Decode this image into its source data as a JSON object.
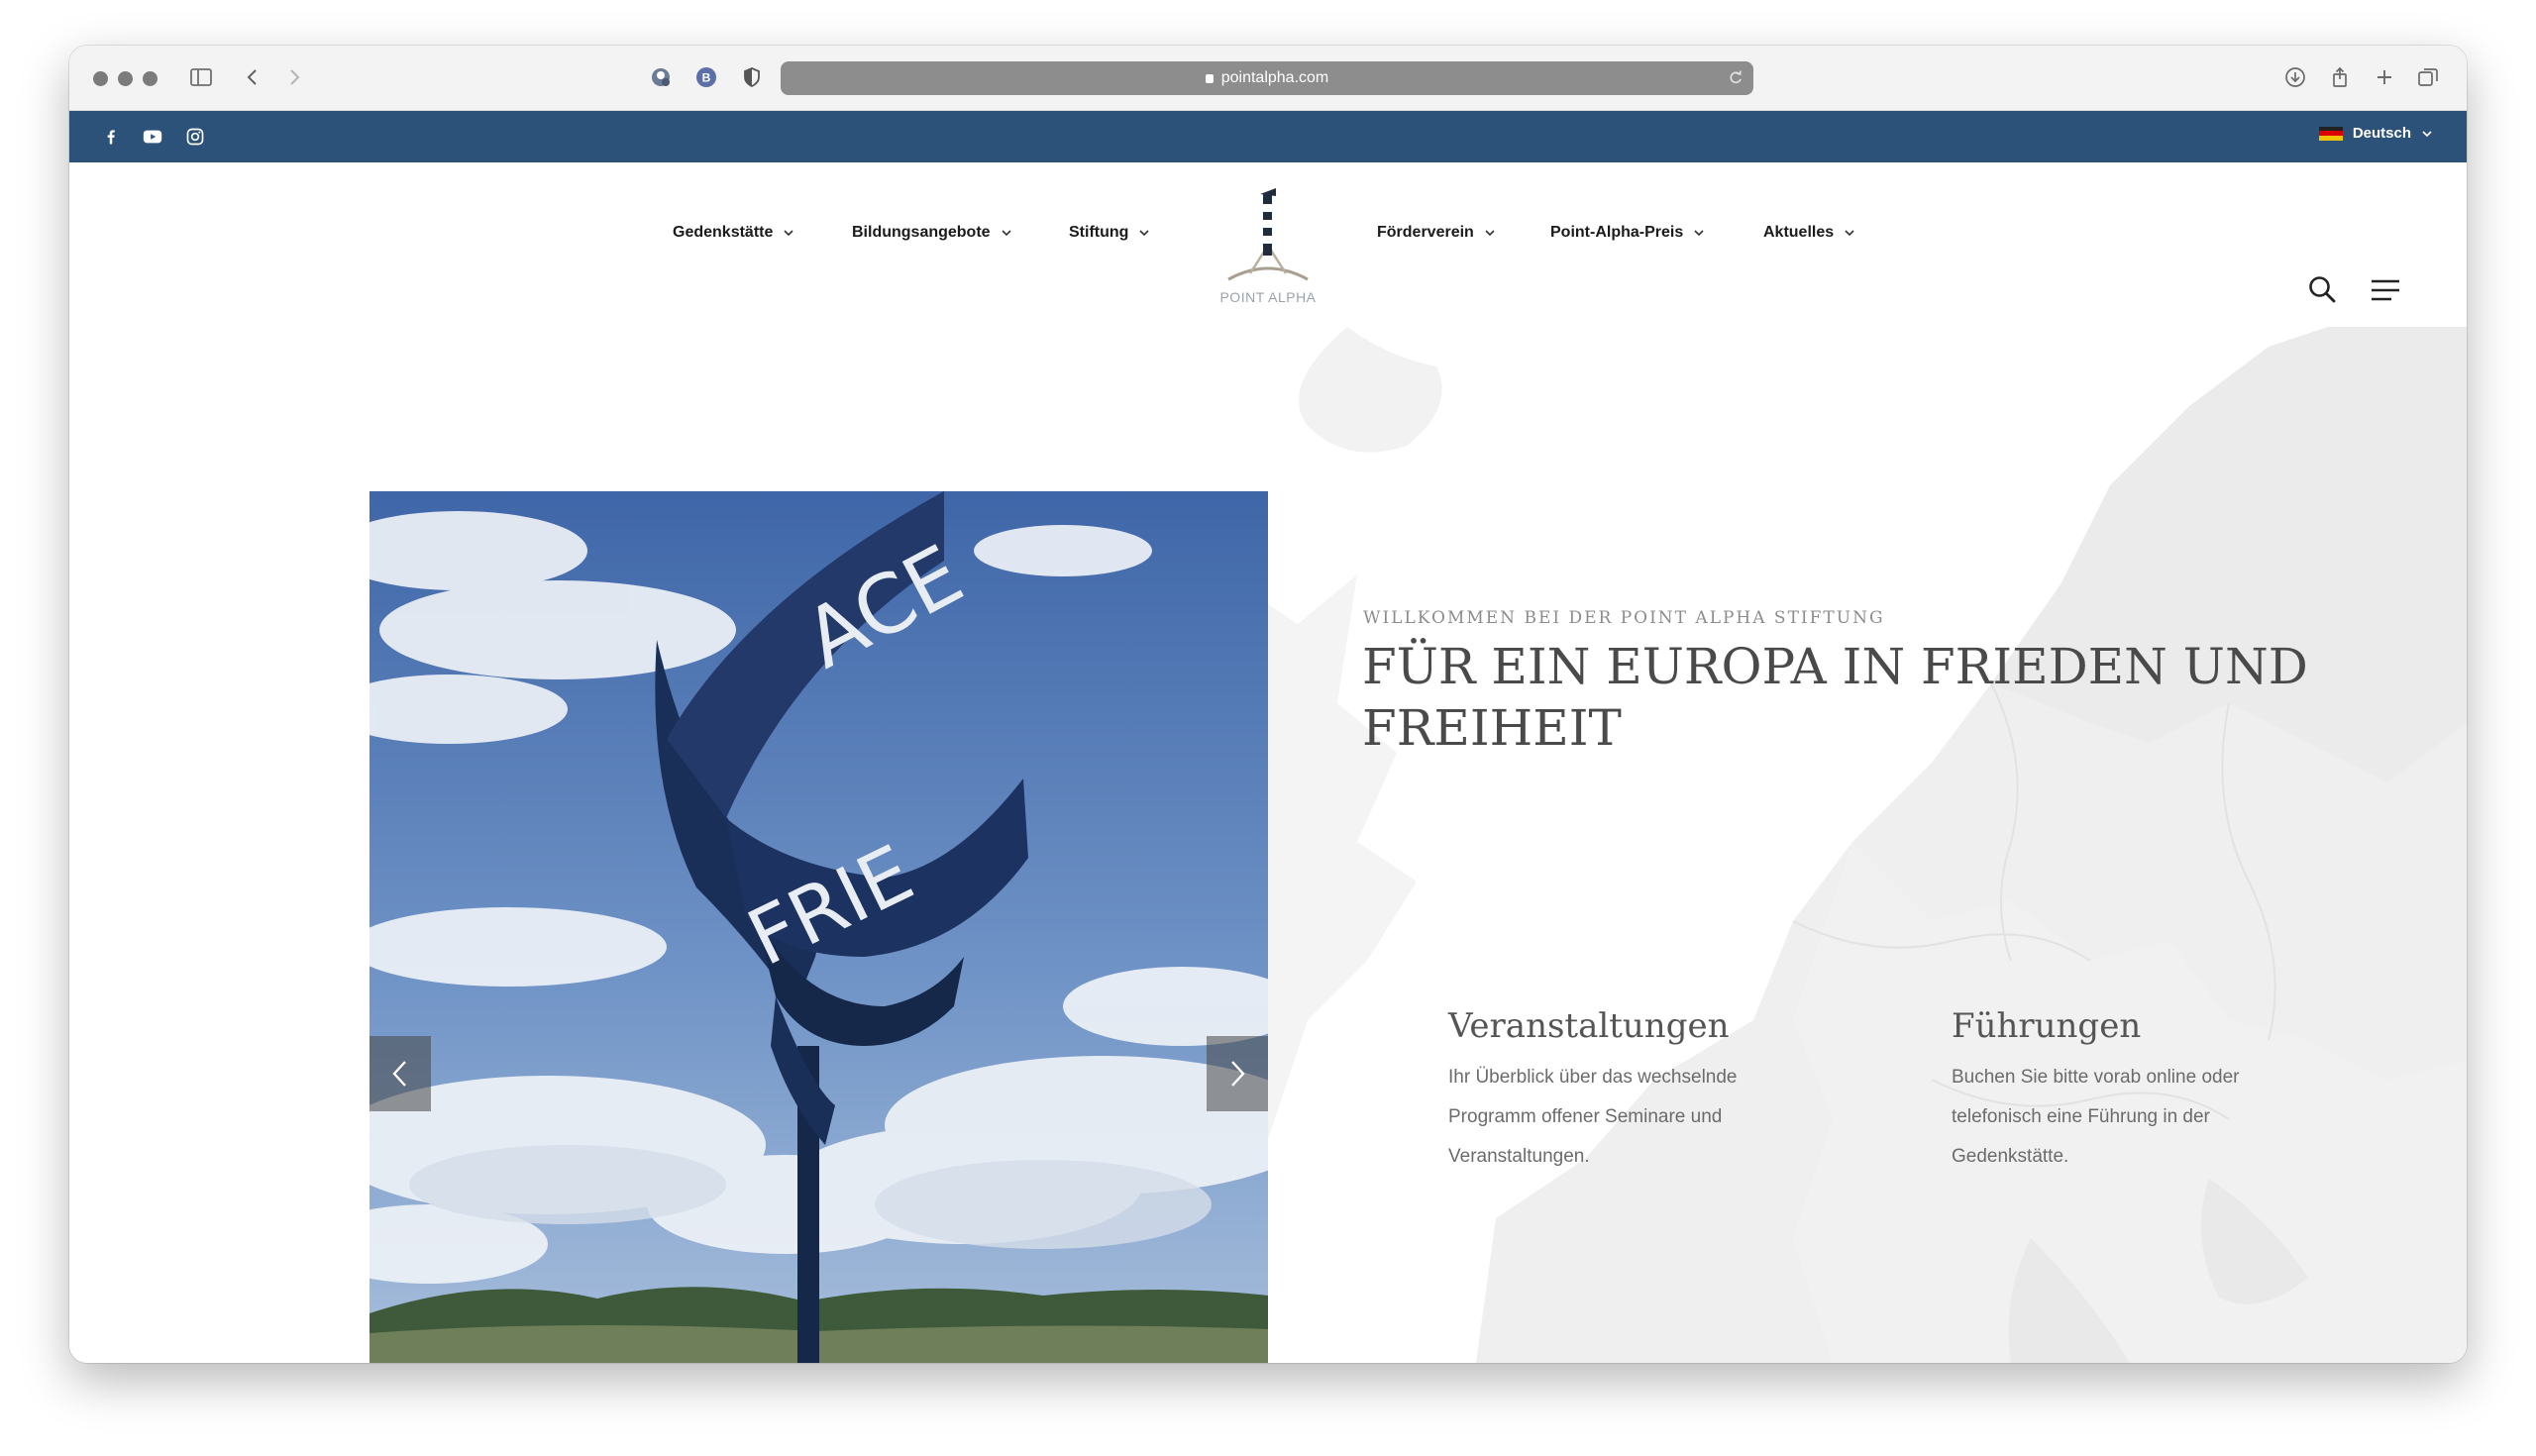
{
  "browser": {
    "url": "pointalpha.com"
  },
  "topbar": {
    "language": "Deutsch",
    "social": [
      "facebook-icon",
      "youtube-icon",
      "instagram-icon"
    ],
    "color": "#2d5279"
  },
  "nav": {
    "items": [
      {
        "label": "Gedenkstätte"
      },
      {
        "label": "Bildungsangebote"
      },
      {
        "label": "Stiftung"
      },
      {
        "label": "Förderverein"
      },
      {
        "label": "Point-Alpha-Preis"
      },
      {
        "label": "Aktuelles"
      }
    ],
    "logo_text": "POINT ALPHA"
  },
  "hero": {
    "eyebrow": "WILLKOMMEN BEI DER POINT ALPHA STIFTUNG",
    "headline": "FÜR EIN EUROPA IN FRIEDEN UND FREIHEIT",
    "sculpture_words": [
      "ACE",
      "FRIE"
    ]
  },
  "cards": [
    {
      "title": "Veranstaltungen",
      "text": "Ihr Überblick über das wechselnde Programm offener Seminare und Veranstaltungen."
    },
    {
      "title": "Führungen",
      "text": "Buchen Sie bitte vorab online oder telefonisch eine Führung in der Gedenkstätte."
    }
  ]
}
